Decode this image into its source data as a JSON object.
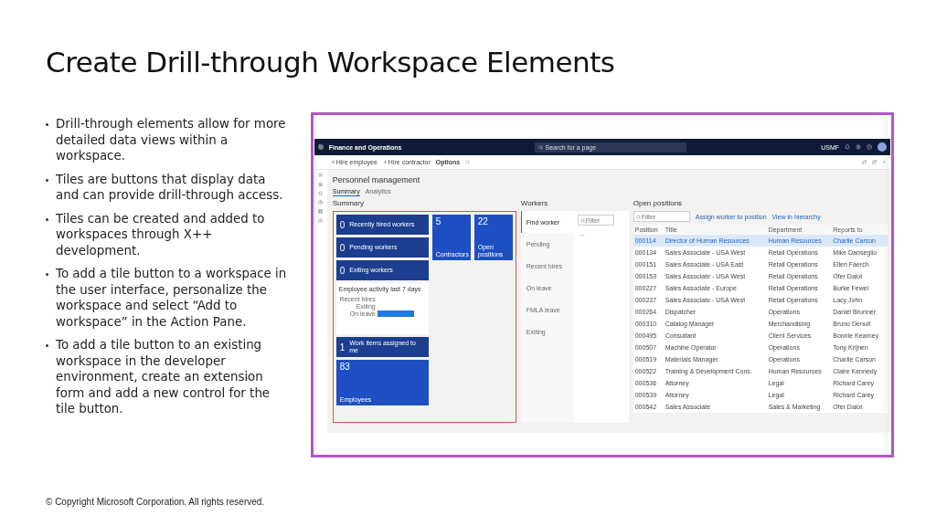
{
  "slide": {
    "title": "Create Drill-through Workspace Elements",
    "bullets": [
      "Drill-through elements allow for more detailed data views within a workspace.",
      "Tiles are buttons that display data and can provide drill-through access.",
      "Tiles can be created and added to workspaces through X++ development.",
      "To add a tile button to a workspace in the user interface, personalize the workspace and select “Add to workspace” in the Action Pane.",
      "To add a tile button to an existing workspace in the developer environment, create an extension form and add a new control for the tile button."
    ],
    "copyright": "© Copyright Microsoft Corporation. All rights reserved."
  },
  "app": {
    "product": "Finance and Operations",
    "search_placeholder": "Search for a page",
    "company": "USMF",
    "actions": [
      "Hire employee",
      "Hire contractor",
      "Options"
    ],
    "page_title": "Personnel management",
    "tabs": [
      {
        "label": "Summary",
        "selected": true
      },
      {
        "label": "Analytics",
        "selected": false
      }
    ],
    "summary": {
      "heading": "Summary",
      "stack": [
        {
          "kind": "wide",
          "count": "0",
          "label": "Recently hired workers"
        },
        {
          "kind": "wide",
          "count": "0",
          "label": "Pending workers"
        },
        {
          "kind": "wide",
          "count": "0",
          "label": "Exiting workers"
        },
        {
          "kind": "chart",
          "title": "Employee activity last 7 days",
          "labels": [
            "Recent hires",
            "Exiting",
            "On leave"
          ]
        },
        {
          "kind": "wide",
          "count": "1",
          "label": "Work items assigned to me"
        },
        {
          "kind": "tall",
          "count": "83",
          "label": "Employees"
        }
      ],
      "side_tiles": [
        {
          "count": "5",
          "label": "Contractors"
        },
        {
          "count": "22",
          "label": "Open positions"
        }
      ]
    },
    "workers": {
      "heading": "Workers",
      "filter_placeholder": "Filter",
      "more": "...",
      "items": [
        {
          "label": "Find worker",
          "selected": true
        },
        {
          "label": "Pending",
          "selected": false
        },
        {
          "label": "Recent hires",
          "selected": false
        },
        {
          "label": "On leave",
          "selected": false
        },
        {
          "label": "FMLA leave",
          "selected": false
        },
        {
          "label": "Exiting",
          "selected": false
        }
      ]
    },
    "open_positions": {
      "heading": "Open positions",
      "filter_placeholder": "Filter",
      "links": [
        "Assign worker to position",
        "View in hierarchy"
      ],
      "columns": [
        "Position",
        "Title",
        "Department",
        "Reports to"
      ],
      "rows": [
        {
          "cells": [
            "000114",
            "Director of Human Resources",
            "Human Resources",
            "Charlie Carson"
          ],
          "selected": true
        },
        {
          "cells": [
            "000134",
            "Sales Associate - USA West",
            "Retail Operations",
            "Mike Danseglio"
          ],
          "selected": false
        },
        {
          "cells": [
            "000151",
            "Sales Associate - USA East",
            "Retail Operations",
            "Ellen Faerch"
          ],
          "selected": false
        },
        {
          "cells": [
            "000153",
            "Sales Associate - USA West",
            "Retail Operations",
            "Ofer Dalot"
          ],
          "selected": false
        },
        {
          "cells": [
            "000227",
            "Sales Associate - Europe",
            "Retail Operations",
            "Burke Fewel"
          ],
          "selected": false
        },
        {
          "cells": [
            "000237",
            "Sales Associate - USA West",
            "Retail Operations",
            "Lacy John"
          ],
          "selected": false
        },
        {
          "cells": [
            "000264",
            "Dispatcher",
            "Operations",
            "Daniel Brunner"
          ],
          "selected": false
        },
        {
          "cells": [
            "000310",
            "Catalog Manager",
            "Merchandising",
            "Bruno Denuit"
          ],
          "selected": false
        },
        {
          "cells": [
            "000495",
            "Consultant",
            "Client Services",
            "Bonnie Kearney"
          ],
          "selected": false
        },
        {
          "cells": [
            "000507",
            "Machine Operator",
            "Operations",
            "Tony Krijnen"
          ],
          "selected": false
        },
        {
          "cells": [
            "000519",
            "Materials Manager",
            "Operations",
            "Charlie Carson"
          ],
          "selected": false
        },
        {
          "cells": [
            "000522",
            "Training & Development Cons.",
            "Human Resources",
            "Claire Kennedy"
          ],
          "selected": false
        },
        {
          "cells": [
            "000536",
            "Attorney",
            "Legal",
            "Richard Carey"
          ],
          "selected": false
        },
        {
          "cells": [
            "000539",
            "Attorney",
            "Legal",
            "Richard Carey"
          ],
          "selected": false
        },
        {
          "cells": [
            "000542",
            "Sales Associate",
            "Sales & Marketing",
            "Ofer Dalot"
          ],
          "selected": false
        }
      ]
    }
  }
}
